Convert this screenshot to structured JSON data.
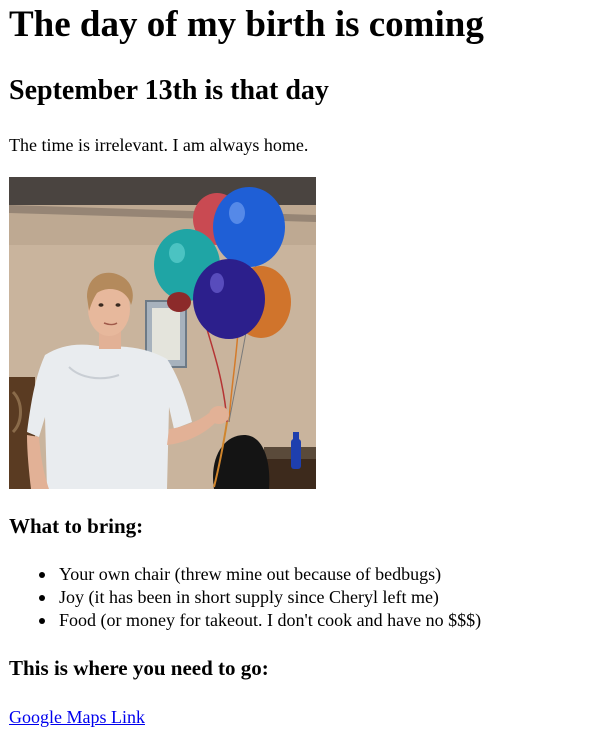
{
  "header": {
    "title": "The day of my birth is coming",
    "subtitle": "September 13th is that day"
  },
  "intro": {
    "text": "The time is irrelevant. I am always home."
  },
  "photo": {
    "description_icon": "birthday-photo"
  },
  "bring": {
    "heading": "What to bring:",
    "items": [
      "Your own chair (threw mine out because of bedbugs)",
      "Joy (it has been in short supply since Cheryl left me)",
      "Food (or money for takeout. I don't cook and have no $$$)"
    ]
  },
  "directions": {
    "heading": "This is where you need to go:",
    "link_label": "Google Maps Link"
  },
  "colors": {
    "link": "#0000ee",
    "text": "#000000",
    "background": "#ffffff"
  }
}
